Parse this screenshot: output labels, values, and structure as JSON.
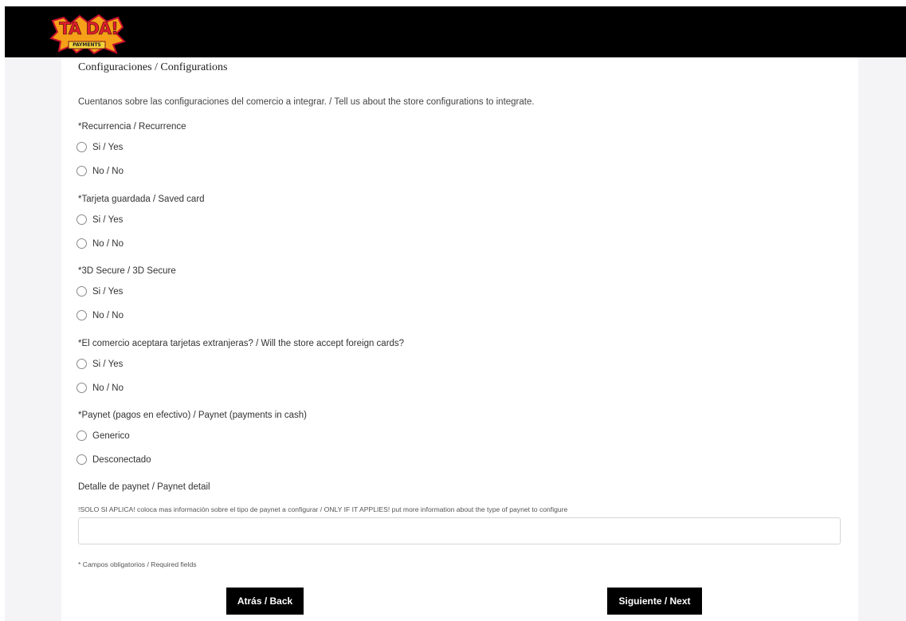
{
  "brand": {
    "logo_text": "TA DA!",
    "logo_subtext": "PAYMENTS"
  },
  "section_title": "Configuraciones / Configurations",
  "intro": "Cuentanos sobre las configuraciones del comercio a integrar. / Tell us about the store configurations to integrate.",
  "questions": [
    {
      "label": "*Recurrencia / Recurrence",
      "options": [
        "Si / Yes",
        "No / No"
      ]
    },
    {
      "label": "*Tarjeta guardada / Saved card",
      "options": [
        "Si / Yes",
        "No / No"
      ]
    },
    {
      "label": "*3D Secure / 3D Secure",
      "options": [
        "Si / Yes",
        "No / No"
      ]
    },
    {
      "label": "*El comercio aceptara tarjetas extranjeras? / Will the store accept foreign cards?",
      "options": [
        "Si / Yes",
        "No / No"
      ]
    },
    {
      "label": "*Paynet (pagos en efectivo) / Paynet (payments in cash)",
      "options": [
        "Generico",
        "Desconectado"
      ]
    }
  ],
  "detail": {
    "label": "Detalle de paynet / Paynet detail",
    "help": "!SOLO SI APLICA! coloca mas información sobre el tipo de paynet a configurar / ONLY IF IT APPLIES! put more information about the type of paynet to configure",
    "value": ""
  },
  "required_note": "* Campos obligatorios / Required fields",
  "buttons": {
    "back": "Atrás / Back",
    "next": "Siguiente / Next"
  },
  "colors": {
    "header_bg": "#000000",
    "button_bg": "#000000",
    "button_text": "#ffffff"
  }
}
